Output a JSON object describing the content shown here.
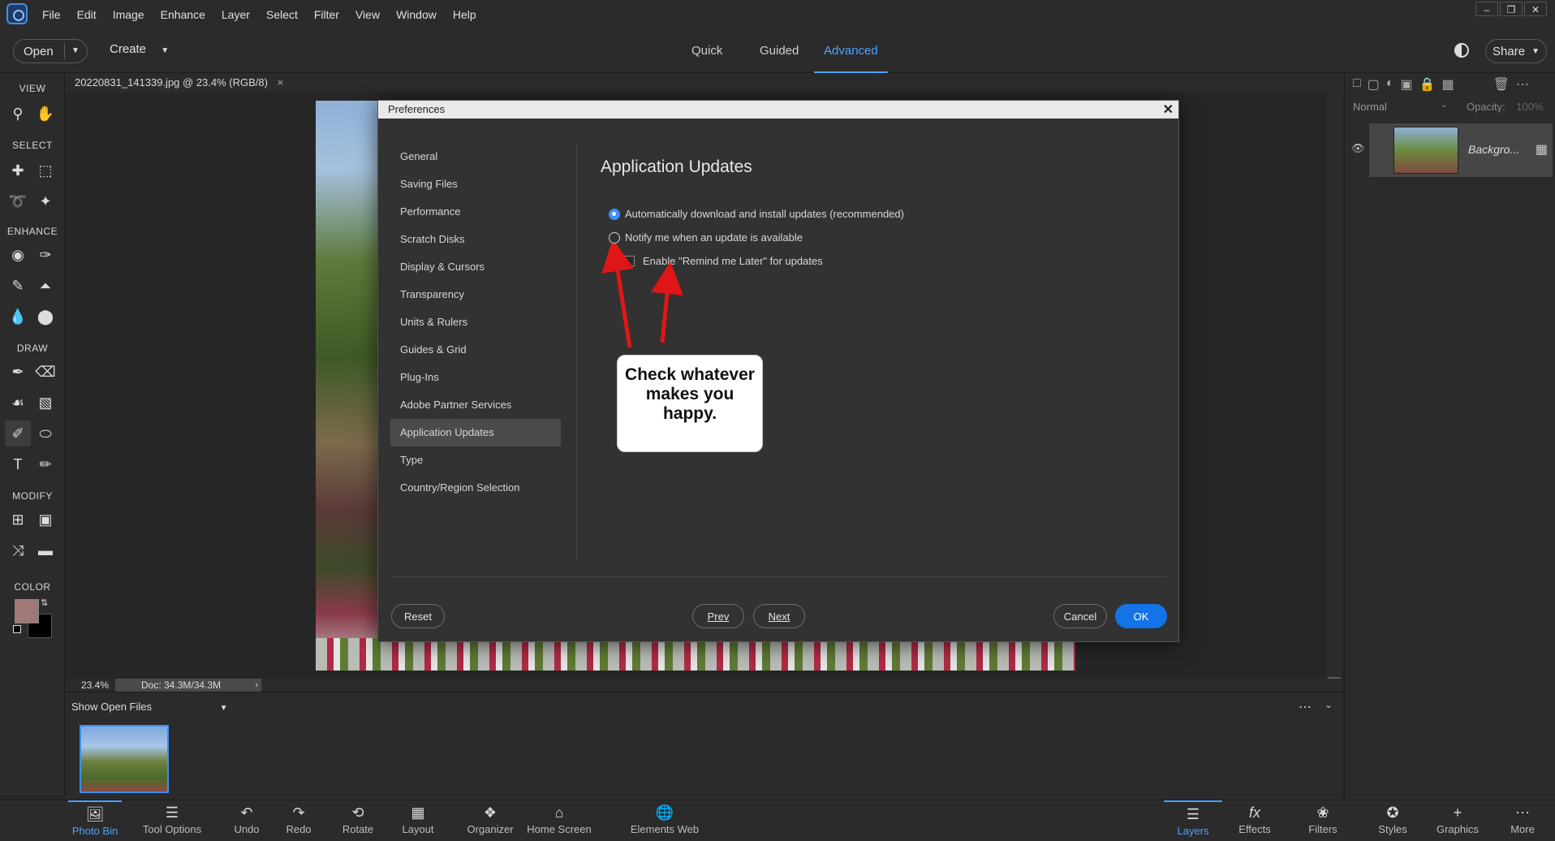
{
  "menubar": {
    "items": [
      "File",
      "Edit",
      "Image",
      "Enhance",
      "Layer",
      "Select",
      "Filter",
      "View",
      "Window",
      "Help"
    ],
    "window_controls": [
      "–",
      "❐",
      "✕"
    ]
  },
  "toolbar": {
    "open_label": "Open",
    "create_label": "Create",
    "modes": [
      "Quick",
      "Guided",
      "Advanced"
    ],
    "share_label": "Share"
  },
  "toolbox": {
    "sections": [
      "VIEW",
      "SELECT",
      "ENHANCE",
      "DRAW",
      "MODIFY",
      "COLOR"
    ]
  },
  "document": {
    "tab_title": "20220831_141339.jpg @ 23.4% (RGB/8)",
    "close_glyph": "×",
    "zoom": "23.4%",
    "doc_size": "Doc: 34.3M/34.3M"
  },
  "photobin": {
    "header": "Show Open Files"
  },
  "layers": {
    "blend_mode": "Normal",
    "opacity_label": "Opacity:",
    "opacity_value": "100%",
    "layer_name": "Backgro..."
  },
  "dialog": {
    "title": "Preferences",
    "close_glyph": "✕",
    "nav": [
      "General",
      "Saving Files",
      "Performance",
      "Scratch Disks",
      "Display & Cursors",
      "Transparency",
      "Units & Rulers",
      "Guides & Grid",
      "Plug-Ins",
      "Adobe Partner Services",
      "Application Updates",
      "Type",
      "Country/Region Selection"
    ],
    "active_nav": "Application Updates",
    "heading": "Application Updates",
    "option_auto": "Automatically download and install updates (recommended)",
    "option_notify": "Notify me when an update is available",
    "option_remind": "Enable \"Remind me Later\" for updates",
    "reset_label": "Reset",
    "prev_label": "Prev",
    "next_label": "Next",
    "cancel_label": "Cancel",
    "ok_label": "OK"
  },
  "annotation": {
    "callout_text": "Check whatever makes you happy."
  },
  "taskbar": {
    "items": [
      "Photo Bin",
      "Tool Options",
      "Undo",
      "Redo",
      "Rotate",
      "Layout",
      "Organizer",
      "Home Screen",
      "Elements Web"
    ],
    "right_items": [
      "Layers",
      "Effects",
      "Filters",
      "Styles",
      "Graphics",
      "More"
    ]
  },
  "colors": {
    "accent": "#1473e6",
    "active_tab": "#4fa2ff",
    "foreground_swatch": "#a07878"
  }
}
